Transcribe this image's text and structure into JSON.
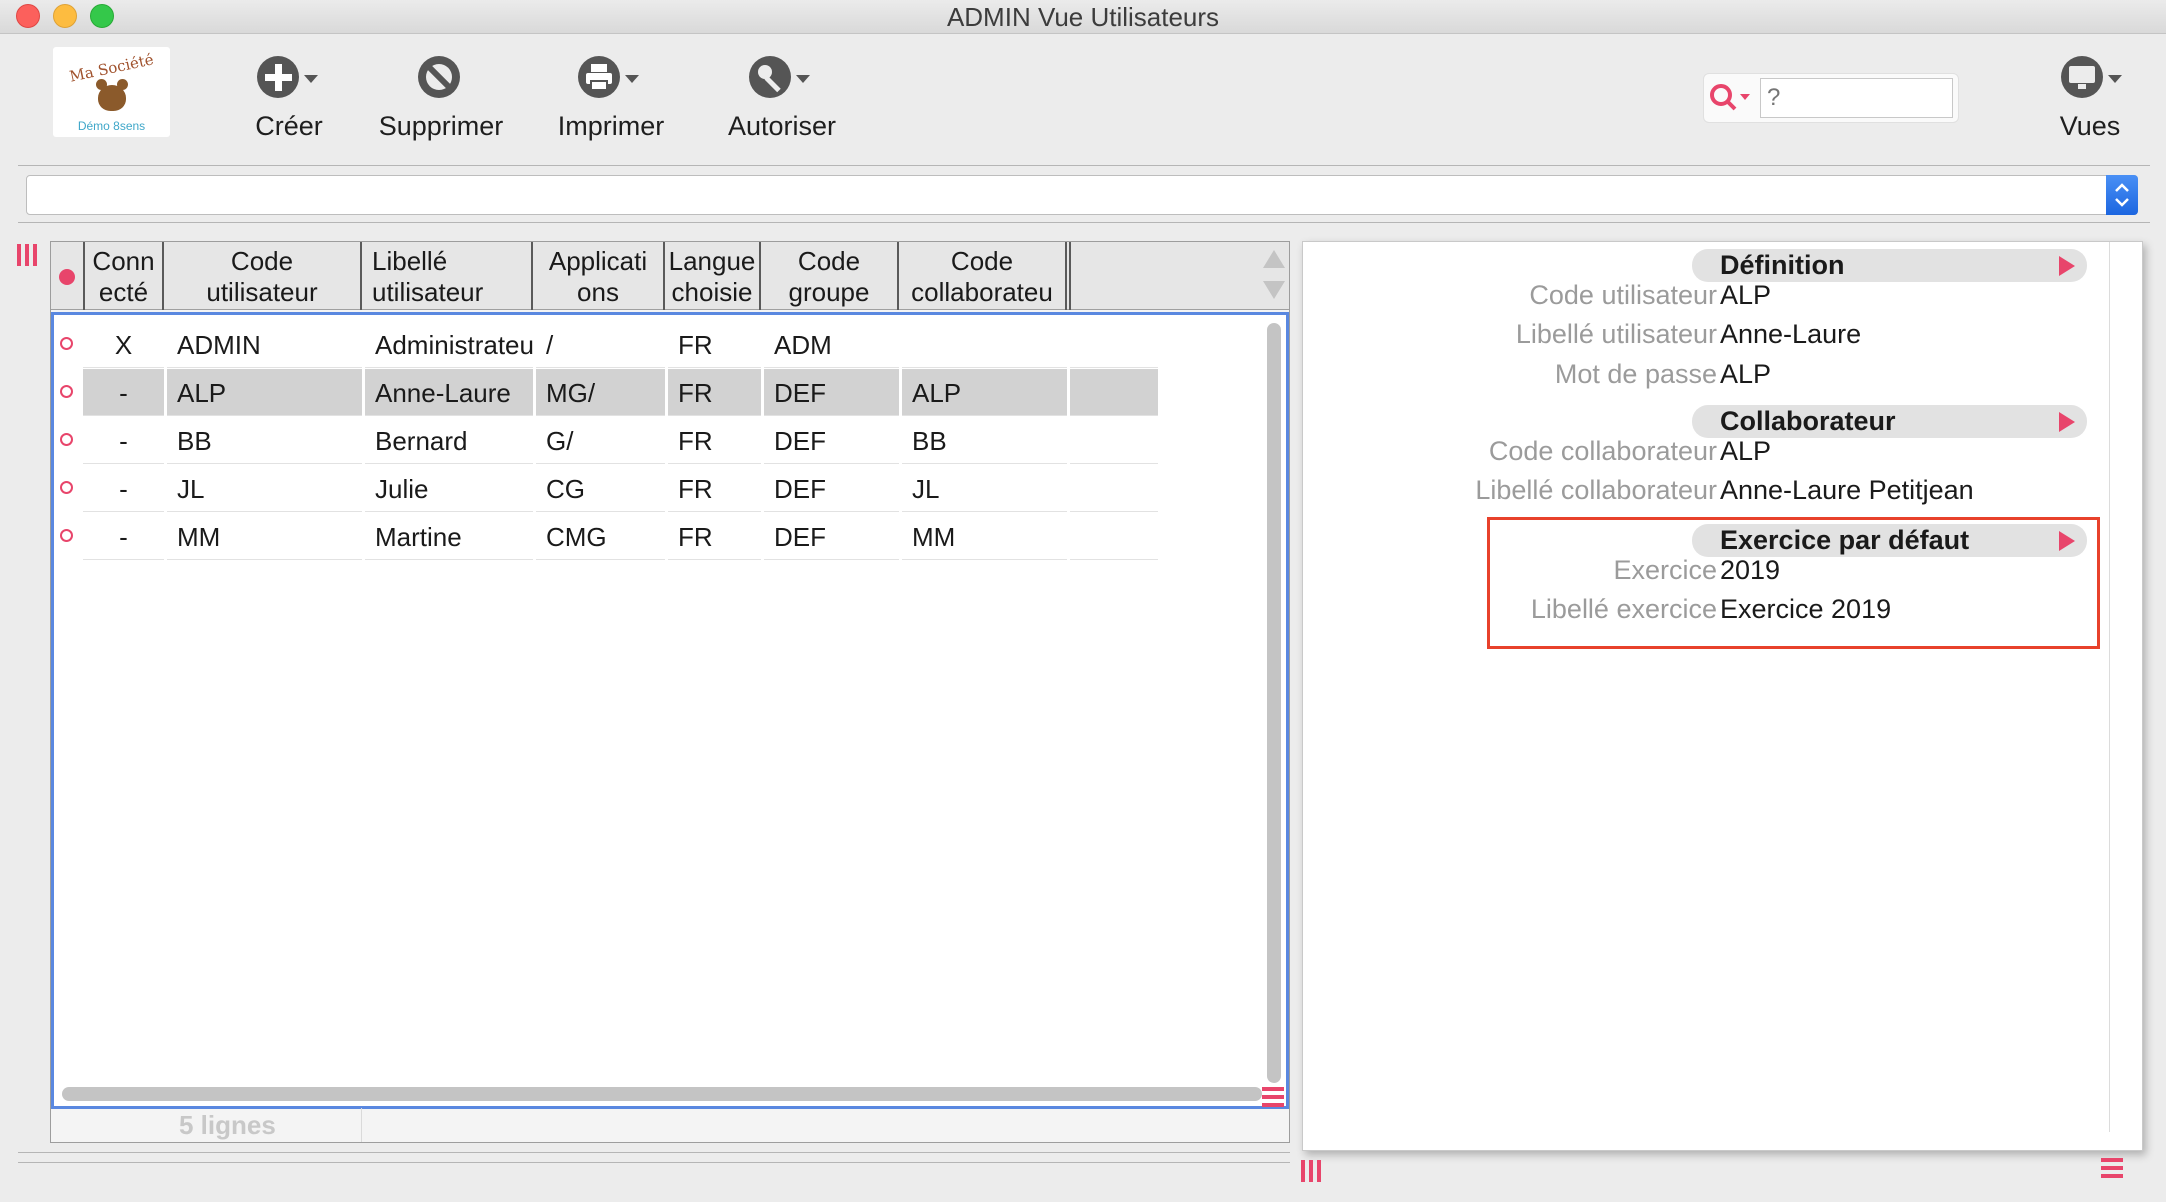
{
  "window": {
    "title": "ADMIN Vue Utilisateurs"
  },
  "logo": {
    "name": "Ma Société",
    "sub": "Démo 8sens"
  },
  "toolbar": {
    "create_label": "Créer",
    "delete_label": "Supprimer",
    "print_label": "Imprimer",
    "authorize_label": "Autoriser",
    "views_label": "Vues",
    "search_placeholder": "?"
  },
  "list": {
    "columns": [
      "Conn ecté",
      "Code utilisateur",
      "Libellé utilisateur",
      "Applicati ons",
      "Langue choisie",
      "Code groupe",
      "Code collaborateu"
    ],
    "column_lines": [
      [
        "Conn",
        "ecté"
      ],
      [
        "Code",
        "utilisateur"
      ],
      [
        "Libellé utilisateur",
        ""
      ],
      [
        "Applicati",
        "ons"
      ],
      [
        "Langue",
        "choisie"
      ],
      [
        "Code",
        "groupe"
      ],
      [
        "Code",
        "collaborateu"
      ]
    ],
    "rows": [
      {
        "connected": "X",
        "code": "ADMIN",
        "label": "Administrateur",
        "apps": "/",
        "lang": "FR",
        "group": "ADM",
        "collab": "",
        "selected": false
      },
      {
        "connected": "-",
        "code": "ALP",
        "label": "Anne-Laure",
        "apps": "MG/",
        "lang": "FR",
        "group": "DEF",
        "collab": "ALP",
        "selected": true
      },
      {
        "connected": "-",
        "code": "BB",
        "label": "Bernard",
        "apps": "G/",
        "lang": "FR",
        "group": "DEF",
        "collab": "BB",
        "selected": false
      },
      {
        "connected": "-",
        "code": "JL",
        "label": "Julie",
        "apps": "CG",
        "lang": "FR",
        "group": "DEF",
        "collab": "JL",
        "selected": false
      },
      {
        "connected": "-",
        "code": "MM",
        "label": "Martine",
        "apps": "CMG",
        "lang": "FR",
        "group": "DEF",
        "collab": "MM",
        "selected": false
      }
    ],
    "footer_count": "5 lignes"
  },
  "detail": {
    "sections": [
      {
        "title": "Définition",
        "fields": [
          {
            "label": "Code utilisateur",
            "value": "ALP"
          },
          {
            "label": "Libellé utilisateur",
            "value": "Anne-Laure"
          },
          {
            "label": "Mot de passe",
            "value": "ALP"
          }
        ]
      },
      {
        "title": "Collaborateur",
        "fields": [
          {
            "label": "Code collaborateur",
            "value": "ALP"
          },
          {
            "label": "Libellé collaborateur",
            "value": "Anne-Laure Petitjean"
          }
        ]
      },
      {
        "title": "Exercice par défaut",
        "fields": [
          {
            "label": "Exercice",
            "value": "2019"
          },
          {
            "label": "Libellé exercice",
            "value": "Exercice 2019"
          }
        ]
      }
    ]
  },
  "colors": {
    "accent_pink": "#e8456b",
    "selection_gray": "#d2d2d2",
    "list_focus_blue": "#5a88e0",
    "highlight_red": "#e8412b"
  }
}
